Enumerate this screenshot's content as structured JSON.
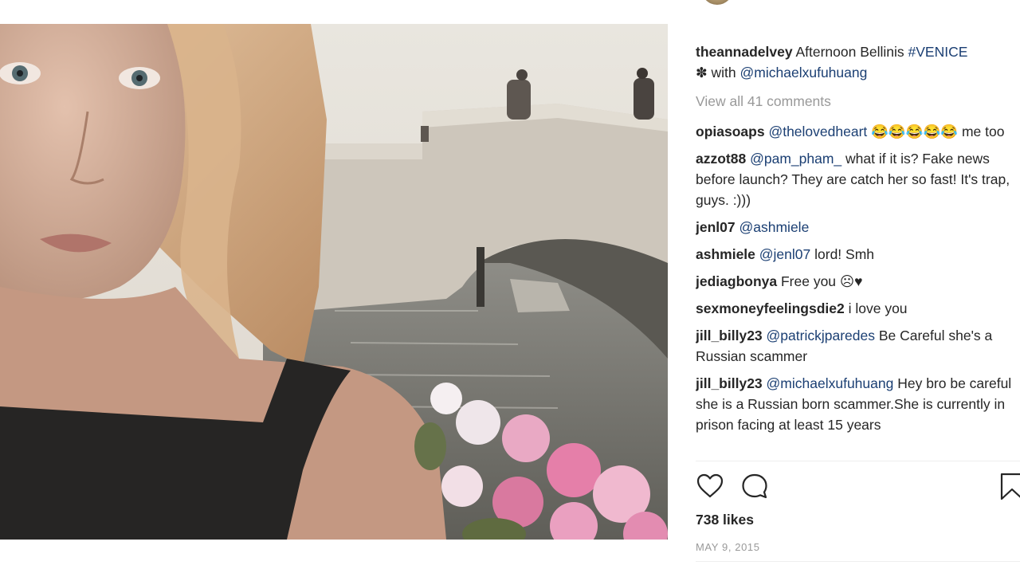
{
  "post": {
    "username": "theannadelvey",
    "caption_text": " Afternoon Bellinis ",
    "caption_tag": "#VENICE",
    "caption_emoji": "✽",
    "caption_with": " with ",
    "caption_mention": "@michaelxufuhuang",
    "view_all_label": "View all 41 comments",
    "likes_label": "738 likes",
    "date_label": "MAY 9, 2015"
  },
  "comments": [
    {
      "user": "opiasoaps",
      "mention": "@thelovedheart",
      "text": " 😂😂😂😂😂 me too"
    },
    {
      "user": "azzot88",
      "mention": "@pam_pham_",
      "text": " what if it is? Fake news before launch? They are catch her so fast! It's trap, guys. :)))"
    },
    {
      "user": "jenl07",
      "mention": "@ashmiele",
      "text": ""
    },
    {
      "user": "ashmiele",
      "mention": "@jenl07",
      "text": " lord! Smh"
    },
    {
      "user": "jediagbonya",
      "mention": "",
      "text": " Free you ☹♥"
    },
    {
      "user": "sexmoneyfeelingsdie2",
      "mention": "",
      "text": " i love you"
    },
    {
      "user": "jill_billy23",
      "mention": "@patrickjparedes",
      "text": " Be Careful she's a Russian scammer"
    },
    {
      "user": "jill_billy23",
      "mention": "@michaelxufuhuang",
      "text": " Hey bro be careful she is a Russian born scammer.She is currently in prison facing at least 15 years"
    }
  ],
  "icons": {
    "like": "heart-icon",
    "comment": "comment-bubble-icon",
    "save": "bookmark-icon"
  },
  "colors": {
    "mention": "#1b3f73",
    "muted": "#999999",
    "text": "#262626"
  }
}
